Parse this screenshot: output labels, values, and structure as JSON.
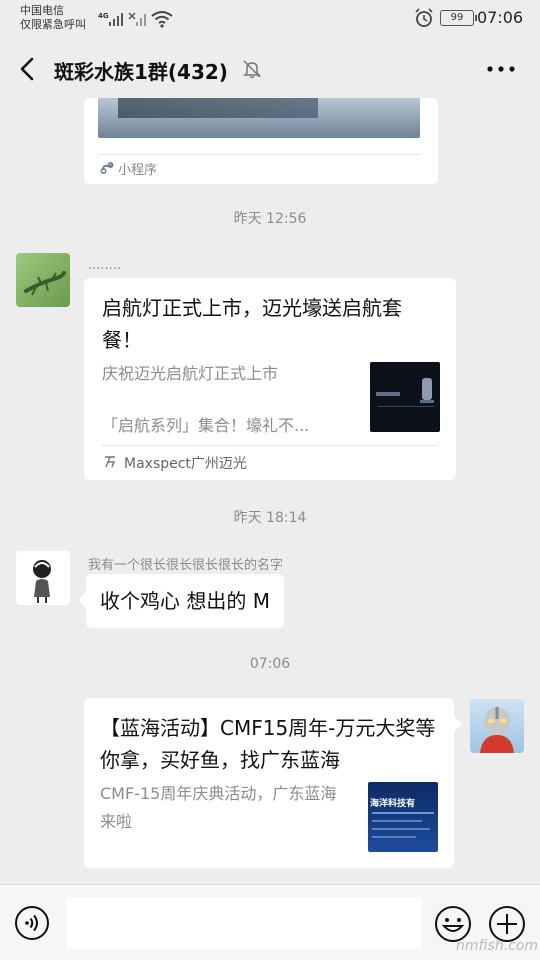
{
  "status_bar": {
    "carrier_line1": "中国电信",
    "carrier_line2": "仅限紧急呼叫",
    "network": "4G",
    "battery": "99",
    "time": "07:06",
    "icons": [
      "signal-icon",
      "no-signal-icon",
      "wifi-icon",
      "alarm-icon",
      "battery-icon"
    ]
  },
  "header": {
    "title": "斑彩水族1群(432)",
    "back_icon": "back-arrow-icon",
    "mute_icon": "mute-bell-icon",
    "more_icon": "more-dots-icon"
  },
  "messages": [
    {
      "type": "mini_program_card",
      "source_label": "小程序",
      "icon": "mini-program-icon"
    },
    {
      "type": "time",
      "text": "昨天 12:56"
    },
    {
      "type": "article_card",
      "sender": "........",
      "title": "启航灯正式上市，迈光壕送启航套餐！",
      "desc_line1": "庆祝迈光启航灯正式上市",
      "desc_line2": "「启航系列」集合！壕礼不...",
      "source": "Maxspect广州迈光"
    },
    {
      "type": "time",
      "text": "昨天 18:14"
    },
    {
      "type": "text",
      "sender": "我有一个很长很长很长很长的名字",
      "text": "收个鸡心 想出的 M"
    },
    {
      "type": "time",
      "text": "07:06"
    },
    {
      "type": "article_card_self",
      "title": "【蓝海活动】CMF15周年-万元大奖等你拿，买好鱼，找广东蓝海",
      "desc": "CMF-15周年庆典活动，广东蓝海来啦",
      "thumb_text": "海洋科技有"
    }
  ],
  "input_bar": {
    "voice_icon": "voice-icon",
    "emoji_icon": "emoji-icon",
    "plus_icon": "plus-icon",
    "input_value": ""
  },
  "watermark": "nmfish.com",
  "colors": {
    "background": "#ededed",
    "bubble": "#ffffff",
    "secondary_text": "#8c8c8c"
  }
}
